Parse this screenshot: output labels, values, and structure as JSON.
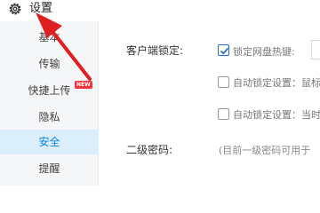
{
  "window": {
    "title": "设置"
  },
  "sidebar": {
    "items": [
      {
        "label": "基本"
      },
      {
        "label": "传输"
      },
      {
        "label": "快捷上传",
        "badge": "NEW"
      },
      {
        "label": "隐私"
      },
      {
        "label": "安全",
        "active": true
      },
      {
        "label": "提醒"
      }
    ]
  },
  "main": {
    "client_lock": {
      "label": "客户端锁定:",
      "options": [
        {
          "label": "锁定网盘热键:",
          "checked": true
        },
        {
          "label": "自动锁定设置：鼠标",
          "checked": false
        },
        {
          "label": "自动锁定设置：当时",
          "checked": false
        }
      ]
    },
    "second_password": {
      "label": "二级密码:",
      "hint": "(目前一级密码可用于"
    }
  },
  "colors": {
    "accent": "#0a84e8",
    "arrow": "#e02020",
    "badge": "#f3343c"
  }
}
